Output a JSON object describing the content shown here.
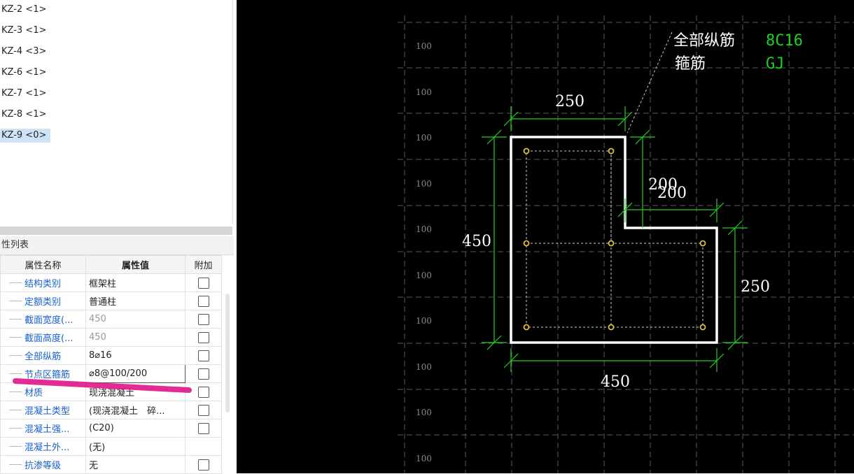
{
  "tree": {
    "items": [
      "KZ-2 <1>",
      "KZ-3 <1>",
      "KZ-4 <3>",
      "KZ-6 <1>",
      "KZ-7 <1>",
      "KZ-8 <1>",
      "KZ-9 <0>"
    ],
    "selected_index": 6
  },
  "props": {
    "header": "性列表",
    "columns": {
      "name": "属性名称",
      "value": "属性值",
      "extra": "附加"
    },
    "rows": [
      {
        "name": "结构类别",
        "value": "框架柱"
      },
      {
        "name": "定额类别",
        "value": "普通柱"
      },
      {
        "name": "截面宽度(...",
        "value": "450"
      },
      {
        "name": "截面高度(...",
        "value": "450"
      },
      {
        "name": "全部纵筋",
        "value": "8⌀16"
      },
      {
        "name": "节点区箍筋",
        "value": "⌀8@100/200"
      },
      {
        "name": "材质",
        "value": "现浇混凝土"
      },
      {
        "name": "混凝土类型",
        "value": "(现浇混凝土　碎..."
      },
      {
        "name": "混凝土强...",
        "value": "(C20)"
      },
      {
        "name": "混凝土外...",
        "value": "(无)"
      },
      {
        "name": "抗渗等级",
        "value": "无"
      }
    ]
  },
  "cad": {
    "grid_labels": [
      "100",
      "100",
      "100",
      "100",
      "100",
      "100",
      "100",
      "100",
      "100",
      "100"
    ],
    "callout": {
      "label1": "全部纵筋",
      "value1": "8C16",
      "label2": "箍筋",
      "value2": "GJ"
    },
    "dims": {
      "top": "250",
      "step_a": "200",
      "step_b": "200",
      "left": "450",
      "right": "250",
      "bottom": "450"
    },
    "colors": {
      "background": "#000000",
      "outline": "#ffffff",
      "dimension": "#1fd11f",
      "rebar": "#d8c43a",
      "highlight": "#e0148a",
      "selection": "#cfe3f8"
    }
  }
}
